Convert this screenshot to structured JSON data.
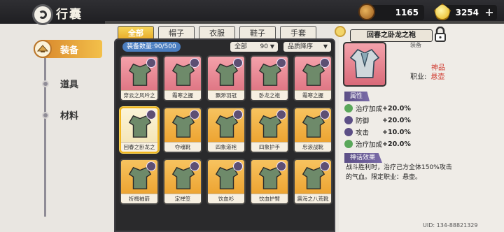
{
  "header": {
    "title": "行囊",
    "currency1": "1165",
    "currency2": "3254",
    "plus_label": "+"
  },
  "sidebar": {
    "items": [
      {
        "label": "装备",
        "active": true
      },
      {
        "label": "道具",
        "active": false
      },
      {
        "label": "材料",
        "active": false
      }
    ]
  },
  "tabs": [
    "全部",
    "帽子",
    "衣服",
    "鞋子",
    "手套"
  ],
  "grid": {
    "count_label": "装备数量:90/500",
    "filter_label": "全部",
    "filter_value": "90",
    "sort_label": "品质降序",
    "items": [
      {
        "name": "穿云之风吟之巧",
        "color": "pink"
      },
      {
        "name": "霜寒之握",
        "color": "pink"
      },
      {
        "name": "飘渺羽冠",
        "color": "pink"
      },
      {
        "name": "卧龙之袍",
        "color": "pink"
      },
      {
        "name": "霜寒之握",
        "color": "pink"
      },
      {
        "name": "回春之卧龙之袍",
        "color": "selected"
      },
      {
        "name": "夺魂靴",
        "color": "orange"
      },
      {
        "name": "四象道袍",
        "color": "orange"
      },
      {
        "name": "四象护手",
        "color": "orange"
      },
      {
        "name": "忠滚战靴",
        "color": "orange"
      },
      {
        "name": "折梅袖箭",
        "color": "orange"
      },
      {
        "name": "定禅笠",
        "color": "orange"
      },
      {
        "name": "饮血衫",
        "color": "orange"
      },
      {
        "name": "饮血护臂",
        "color": "orange"
      },
      {
        "name": "震海之八荒靴",
        "color": "orange"
      }
    ]
  },
  "detail": {
    "name": "回春之卧龙之袍",
    "type": "装备",
    "quality": "神品",
    "job_label": "职业:",
    "job_value": "悬壶",
    "attr_title": "属性",
    "attrs": [
      {
        "name": "治疗加成",
        "value": "+20.0%",
        "color": "#5aa85a"
      },
      {
        "name": "防御",
        "value": "+20.0%",
        "color": "#5c4f86"
      },
      {
        "name": "攻击",
        "value": "+10.0%",
        "color": "#5c4f86"
      },
      {
        "name": "治疗加成",
        "value": "+20.0%",
        "color": "#5aa85a"
      }
    ],
    "effect_title": "神话效果",
    "effect_desc": "战斗胜利时，治疗己方全体150%攻击的气血。限定职业：悬壶。"
  },
  "uid": "UID: 134-88821329"
}
